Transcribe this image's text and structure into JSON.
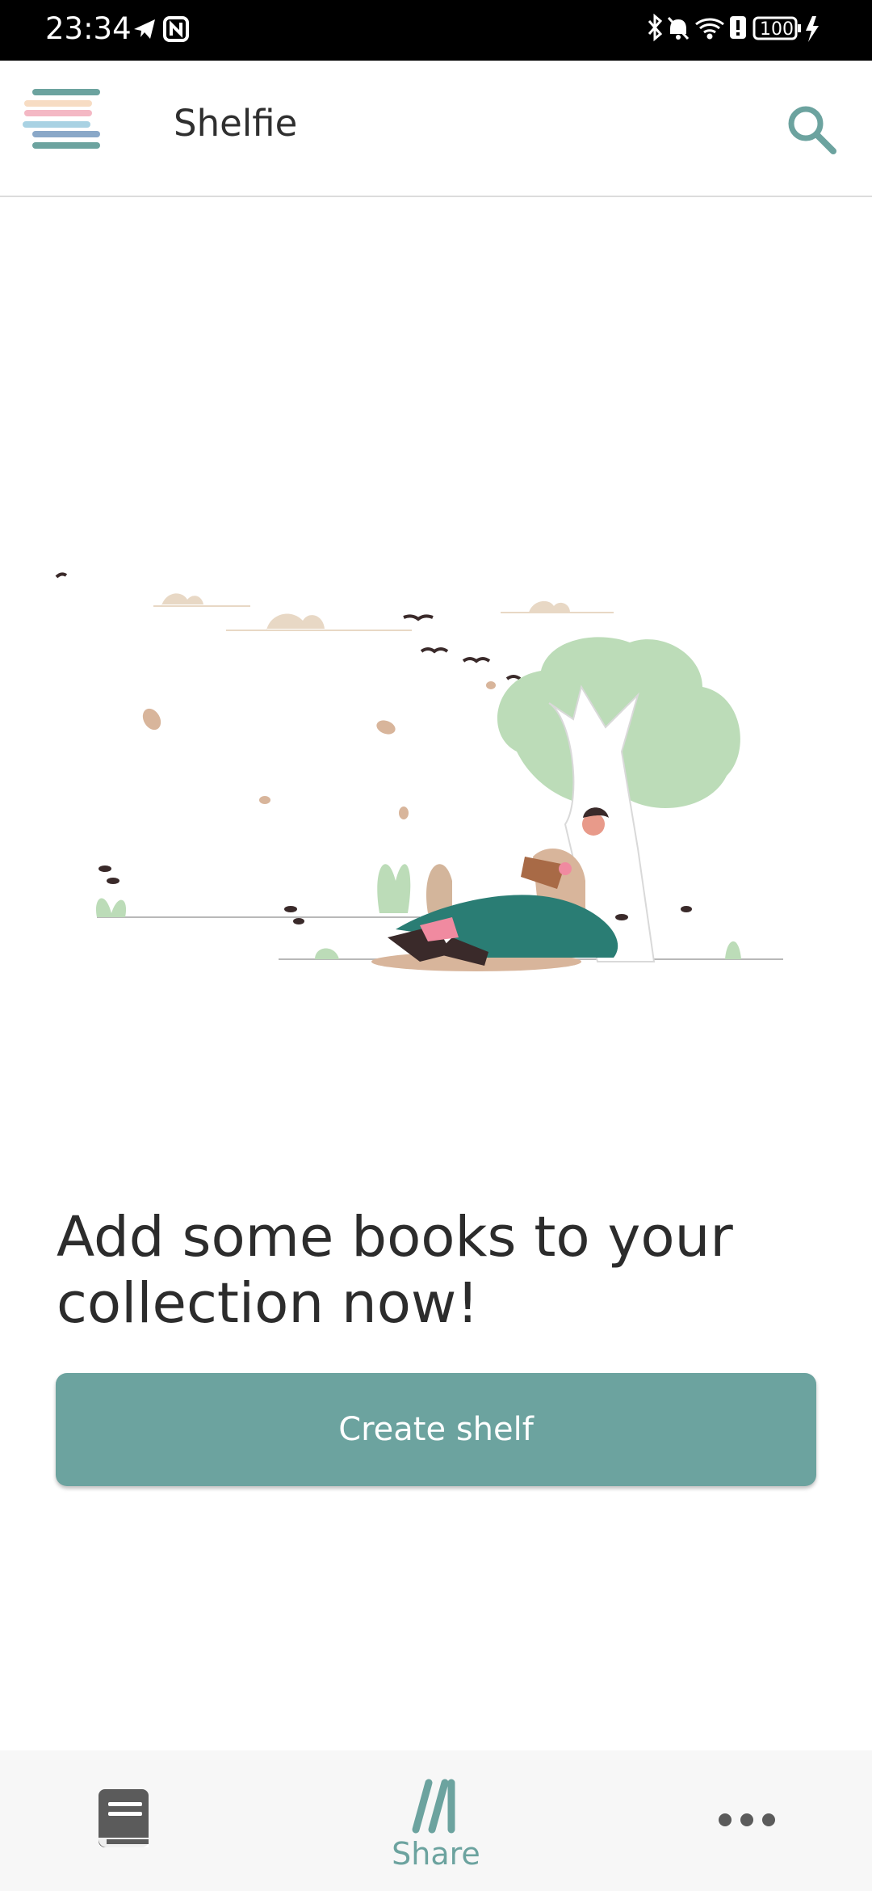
{
  "status_bar": {
    "time": "23:34",
    "battery": "100",
    "icons": [
      "telegram-icon",
      "nfc-icon",
      "bluetooth-icon",
      "bell-off-icon",
      "wifi-icon",
      "alert-icon",
      "battery-icon",
      "charging-icon"
    ]
  },
  "app_bar": {
    "title": "Shelfie",
    "menu_icon": "hamburger-menu-icon",
    "search_icon": "search-icon"
  },
  "empty_state": {
    "illustration": "person-reading-under-tree-illustration",
    "headline": "Add some books to your collection now!",
    "button_label": "Create shelf"
  },
  "bottom_nav": {
    "items": [
      {
        "icon": "book-icon",
        "label": ""
      },
      {
        "icon": "share-icon",
        "label": "Share"
      },
      {
        "icon": "more-icon",
        "label": ""
      }
    ]
  },
  "colors": {
    "accent": "#6ca39f",
    "menu_stripes": [
      "#6ca39f",
      "#f7dcc3",
      "#f4b8c4",
      "#a9d2e3",
      "#8aa8c8",
      "#6ca39f"
    ],
    "tree": "#bcdcb8",
    "pants": "#2a7d74",
    "clouds": "#e8d8c5"
  }
}
